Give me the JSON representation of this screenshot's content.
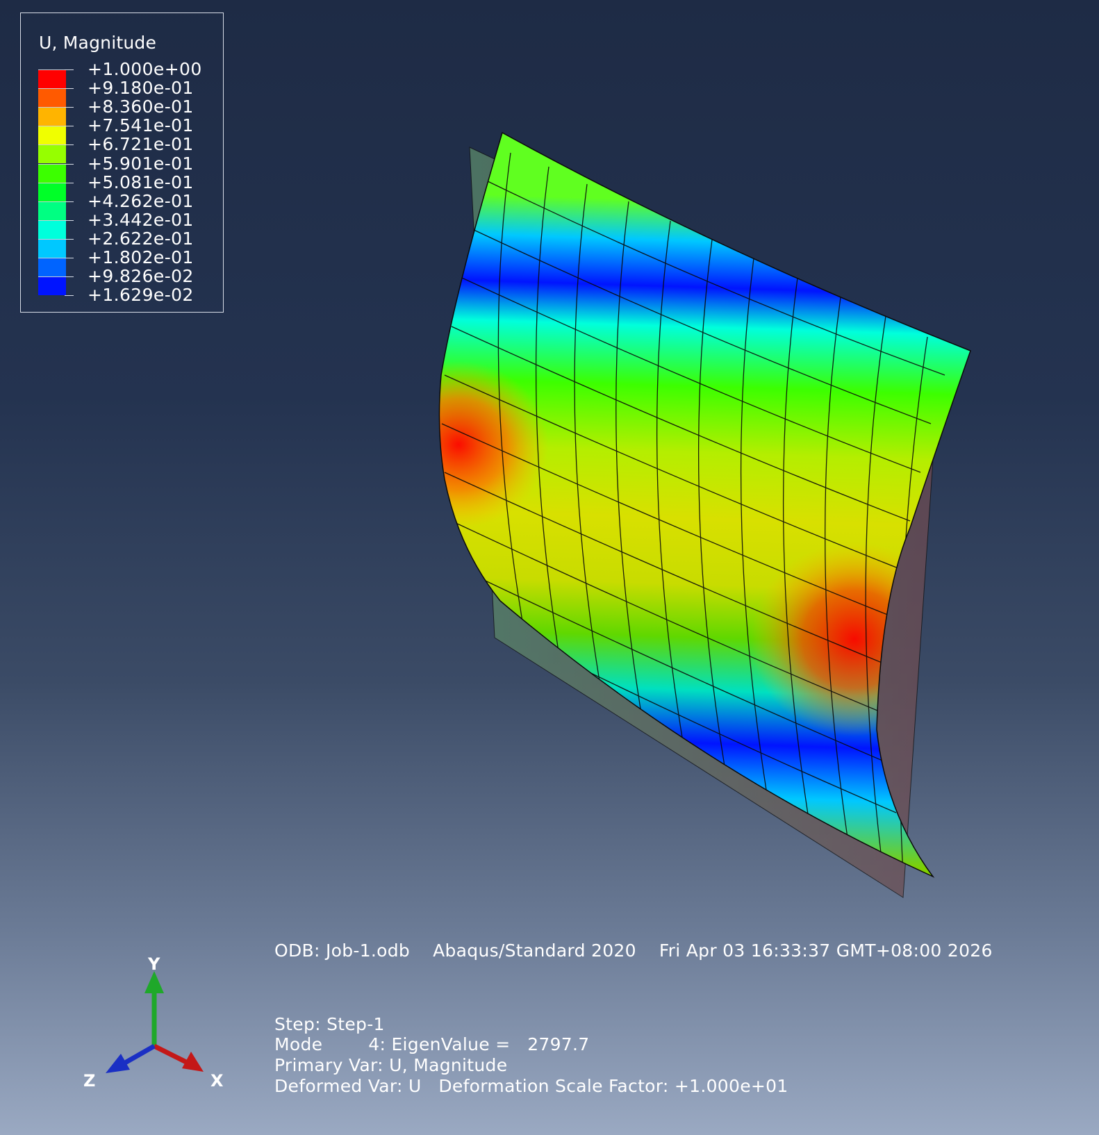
{
  "legend": {
    "title": "U, Magnitude",
    "entries": [
      {
        "label": "+1.000e+00",
        "color": "#ff0000"
      },
      {
        "label": "+9.180e-01",
        "color": "#ff5a00"
      },
      {
        "label": "+8.360e-01",
        "color": "#ffb400"
      },
      {
        "label": "+7.541e-01",
        "color": "#f0ff00"
      },
      {
        "label": "+6.721e-01",
        "color": "#96ff00"
      },
      {
        "label": "+5.901e-01",
        "color": "#3cff00"
      },
      {
        "label": "+5.081e-01",
        "color": "#00ff28"
      },
      {
        "label": "+4.262e-01",
        "color": "#00ff82"
      },
      {
        "label": "+3.442e-01",
        "color": "#00ffdc"
      },
      {
        "label": "+2.622e-01",
        "color": "#00c8ff"
      },
      {
        "label": "+1.802e-01",
        "color": "#0064ff"
      },
      {
        "label": "+9.826e-02",
        "color": "#0014ff"
      },
      {
        "label": "+1.629e-02",
        "color": "#0000ff"
      }
    ]
  },
  "info": {
    "odb_line": "ODB: Job-1.odb    Abaqus/Standard 2020    Fri Apr 03 16:33:37 GMT+08:00 2026",
    "step_line": "Step: Step-1",
    "mode_line": "Mode        4: EigenValue =   2797.7",
    "primary_line": "Primary Var: U, Magnitude",
    "deformed_line": "Deformed Var: U   Deformation Scale Factor: +1.000e+01"
  },
  "triad": {
    "y_label": "Y",
    "z_label": "Z",
    "x_label": "X",
    "y_color": "#1fa82a",
    "x_color": "#c41818",
    "z_color": "#1a2fc4"
  }
}
